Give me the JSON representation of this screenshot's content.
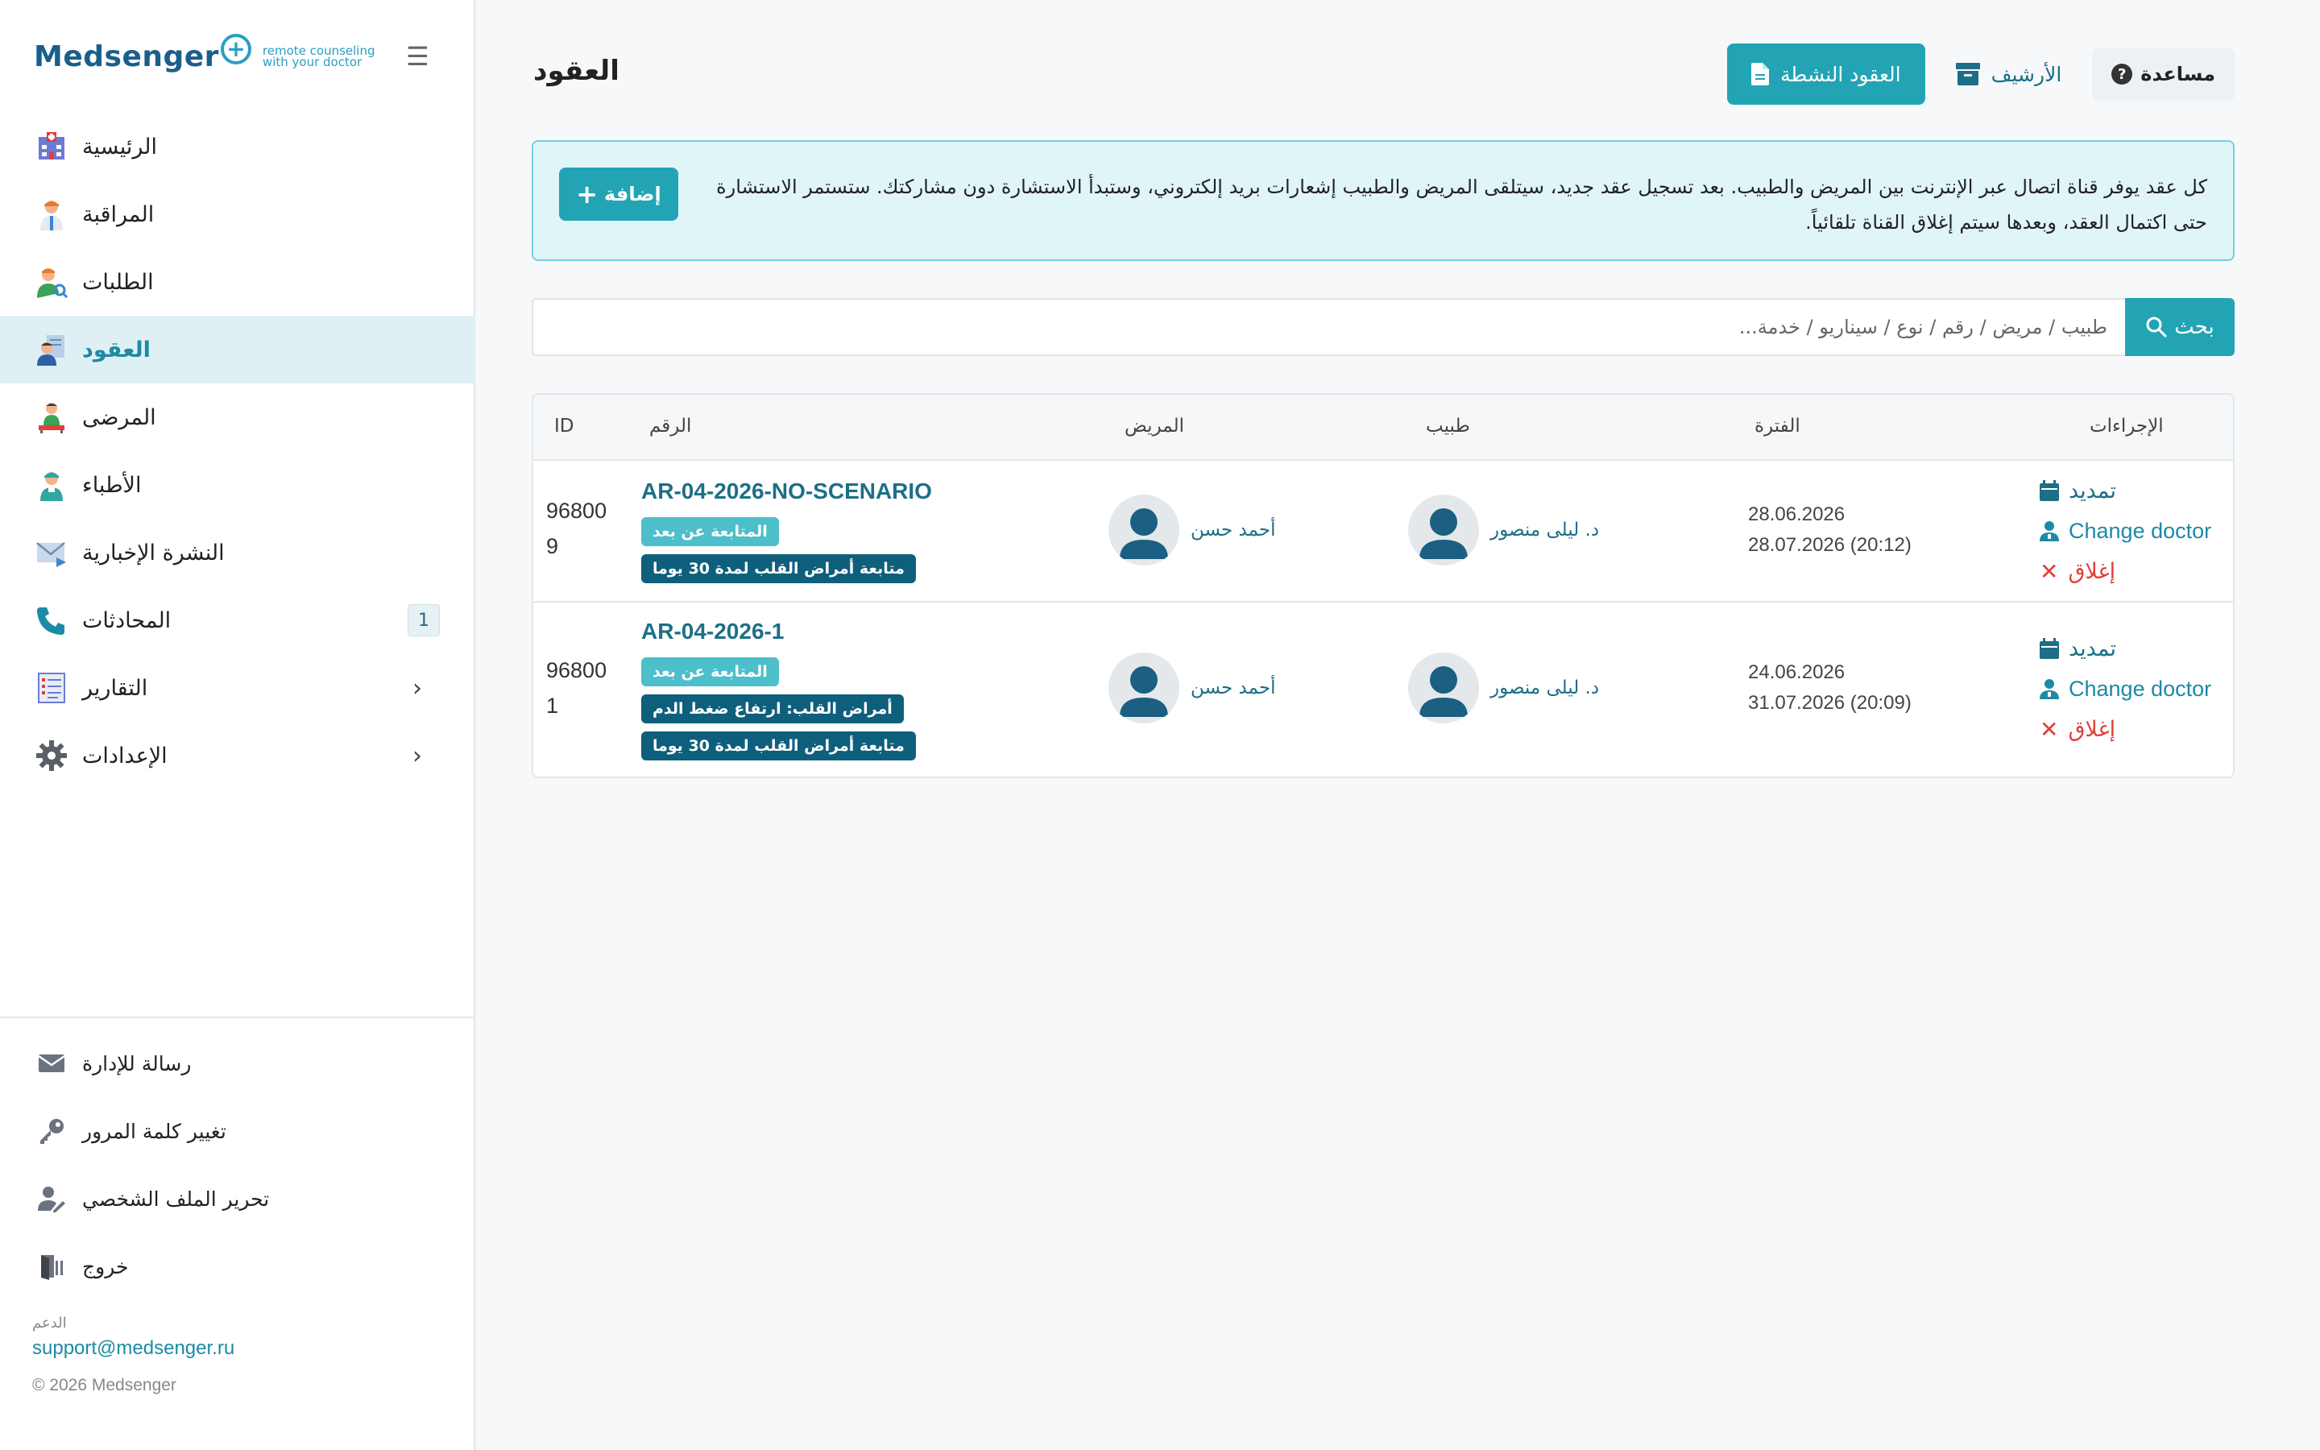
{
  "brand": {
    "name": "Medsenger",
    "tagline_line1": "remote counseling",
    "tagline_line2": "with your doctor",
    "colors": {
      "primary": "#1a5f8c",
      "accent": "#23a4b5"
    }
  },
  "sidebar": {
    "menu_icon": "hamburger-icon",
    "items": [
      {
        "label": "الرئيسية",
        "icon": "hospital-icon",
        "active": false
      },
      {
        "label": "المراقبة",
        "icon": "doctor-icon",
        "active": false
      },
      {
        "label": "الطلبات",
        "icon": "user-search-icon",
        "active": false
      },
      {
        "label": "العقود",
        "icon": "contract-user-icon",
        "active": true
      },
      {
        "label": "المرضى",
        "icon": "patient-icon",
        "active": false
      },
      {
        "label": "الأطباء",
        "icon": "nurse-icon",
        "active": false
      },
      {
        "label": "النشرة الإخبارية",
        "icon": "mail-icon",
        "active": false
      },
      {
        "label": "المحادثات",
        "icon": "phone-icon",
        "active": false,
        "badge": "1"
      },
      {
        "label": "التقارير",
        "icon": "report-icon",
        "active": false,
        "chevron": "›"
      },
      {
        "label": "الإعدادات",
        "icon": "gear-icon",
        "active": false,
        "chevron": "›"
      }
    ],
    "footer_items": [
      {
        "label": "رسالة للإدارة",
        "icon": "envelope-icon"
      },
      {
        "label": "تغيير كلمة المرور",
        "icon": "key-icon"
      },
      {
        "label": "تحرير الملف الشخصي",
        "icon": "user-edit-icon"
      },
      {
        "label": "خروج",
        "icon": "door-exit-icon"
      }
    ],
    "support_label": "الدعم",
    "support_email": "support@medsenger.ru",
    "copyright": "© 2026 Medsenger"
  },
  "header": {
    "title": "العقود",
    "active_contracts_label": "العقود النشطة",
    "archive_label": "الأرشيف",
    "help_label": "مساعدة"
  },
  "info": {
    "text": "كل عقد يوفر قناة اتصال عبر الإنترنت بين المريض والطبيب. بعد تسجيل عقد جديد، سيتلقى المريض والطبيب إشعارات بريد إلكتروني، وستبدأ الاستشارة دون مشاركتك. ستستمر الاستشارة حتى اكتمال العقد، وبعدها سيتم إغلاق القناة تلقائياً.",
    "add_label": "إضافة"
  },
  "search": {
    "placeholder": "طبيب / مريض / رقم / نوع / سيناريو / خدمة...",
    "button_label": "بحث"
  },
  "table": {
    "headers": {
      "id": "ID",
      "number": "الرقم",
      "patient": "المريض",
      "doctor": "طبيب",
      "period": "الفترة",
      "actions": "الإجراءات"
    },
    "rows": [
      {
        "id": "968009",
        "number": "AR-04-2026-NO-SCENARIO",
        "badges": [
          {
            "text": "المتابعة عن بعد",
            "style": "light"
          },
          {
            "text": "متابعة أمراض القلب لمدة 30 يوما",
            "style": "dark"
          }
        ],
        "patient": "أحمد حسن",
        "doctor": "د. ليلى منصور",
        "period_start": "28.06.2026",
        "period_end": "28.07.2026 (20:12)",
        "actions": {
          "extend": "تمديد",
          "change": "Change doctor",
          "close": "إغلاق"
        }
      },
      {
        "id": "968001",
        "number": "AR-04-2026-1",
        "badges": [
          {
            "text": "المتابعة عن بعد",
            "style": "light"
          },
          {
            "text": "أمراض القلب: ارتفاع ضغط الدم",
            "style": "dark"
          },
          {
            "text": "متابعة أمراض القلب لمدة 30 يوما",
            "style": "dark"
          }
        ],
        "patient": "أحمد حسن",
        "doctor": "د. ليلى منصور",
        "period_start": "24.06.2026",
        "period_end": "31.07.2026 (20:09)",
        "actions": {
          "extend": "تمديد",
          "change": "Change doctor",
          "close": "إغلاق"
        }
      }
    ]
  }
}
